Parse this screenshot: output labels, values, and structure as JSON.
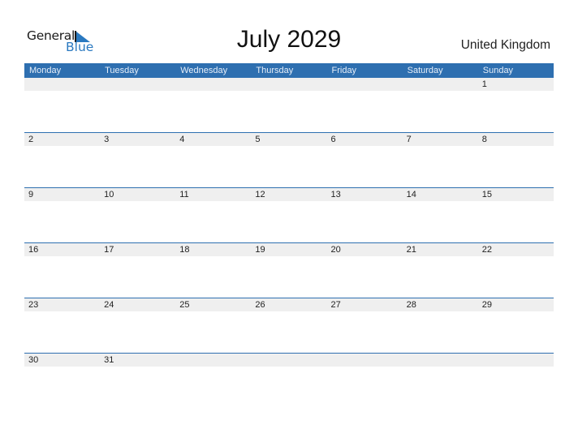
{
  "logo": {
    "word1": "General",
    "word2": "Blue"
  },
  "title": "July 2029",
  "country": "United Kingdom",
  "colors": {
    "accent": "#2e6fb0",
    "band": "#efefef",
    "logo_blue": "#2a79c0"
  },
  "weekdays": [
    "Monday",
    "Tuesday",
    "Wednesday",
    "Thursday",
    "Friday",
    "Saturday",
    "Sunday"
  ],
  "weeks": [
    [
      "",
      "",
      "",
      "",
      "",
      "",
      "1"
    ],
    [
      "2",
      "3",
      "4",
      "5",
      "6",
      "7",
      "8"
    ],
    [
      "9",
      "10",
      "11",
      "12",
      "13",
      "14",
      "15"
    ],
    [
      "16",
      "17",
      "18",
      "19",
      "20",
      "21",
      "22"
    ],
    [
      "23",
      "24",
      "25",
      "26",
      "27",
      "28",
      "29"
    ],
    [
      "30",
      "31",
      "",
      "",
      "",
      "",
      ""
    ]
  ]
}
